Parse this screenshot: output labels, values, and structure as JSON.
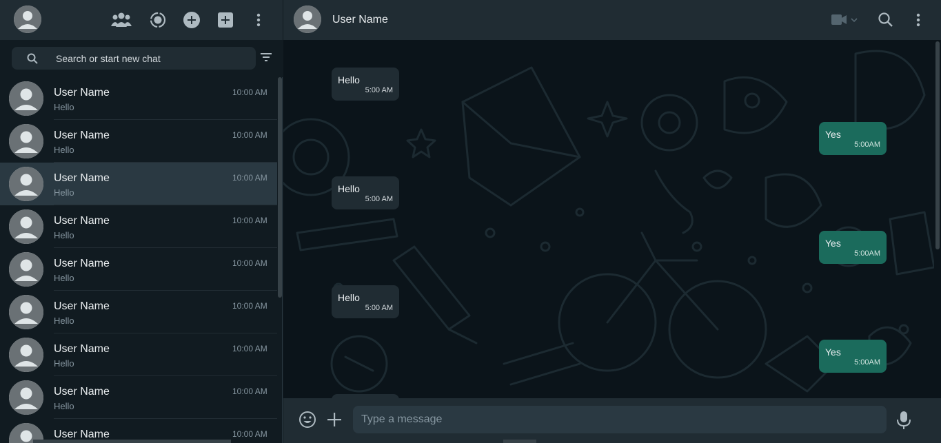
{
  "sidebar": {
    "icons": [
      "user-avatar",
      "communities-icon",
      "status-icon",
      "new-channel-icon",
      "new-chat-icon",
      "menu-icon"
    ],
    "search": {
      "placeholder": "Search or start new chat"
    },
    "chats": [
      {
        "name": "User Name",
        "last_message": "Hello",
        "time": "10:00 AM",
        "active": false
      },
      {
        "name": "User Name",
        "last_message": "Hello",
        "time": "10:00 AM",
        "active": false
      },
      {
        "name": "User Name",
        "last_message": "Hello",
        "time": "10:00 AM",
        "active": true
      },
      {
        "name": "User Name",
        "last_message": "Hello",
        "time": "10:00 AM",
        "active": false
      },
      {
        "name": "User Name",
        "last_message": "Hello",
        "time": "10:00 AM",
        "active": false
      },
      {
        "name": "User Name",
        "last_message": "Hello",
        "time": "10:00 AM",
        "active": false
      },
      {
        "name": "User Name",
        "last_message": "Hello",
        "time": "10:00 AM",
        "active": false
      },
      {
        "name": "User Name",
        "last_message": "Hello",
        "time": "10:00 AM",
        "active": false
      },
      {
        "name": "User Name",
        "last_message": "",
        "time": "10:00 AM",
        "active": false
      }
    ]
  },
  "chat": {
    "header": {
      "title": "User Name"
    },
    "messages": [
      {
        "direction": "in",
        "text": "Hello",
        "time": "5:00 AM"
      },
      {
        "direction": "out",
        "text": "Yes",
        "time": "5:00AM"
      },
      {
        "direction": "in",
        "text": "Hello",
        "time": "5:00 AM"
      },
      {
        "direction": "out",
        "text": "Yes",
        "time": "5:00AM"
      },
      {
        "direction": "in",
        "text": "Hello",
        "time": "5:00 AM"
      },
      {
        "direction": "out",
        "text": "Yes",
        "time": "5:00AM"
      }
    ],
    "composer": {
      "placeholder": "Type a message"
    }
  },
  "colors": {
    "background": "#111b21",
    "panel": "#202c33",
    "outgoing_bubble": "#1b6b5c",
    "incoming_bubble": "#202c33",
    "primary_text": "#e9edef",
    "secondary_text": "#8696a0"
  }
}
